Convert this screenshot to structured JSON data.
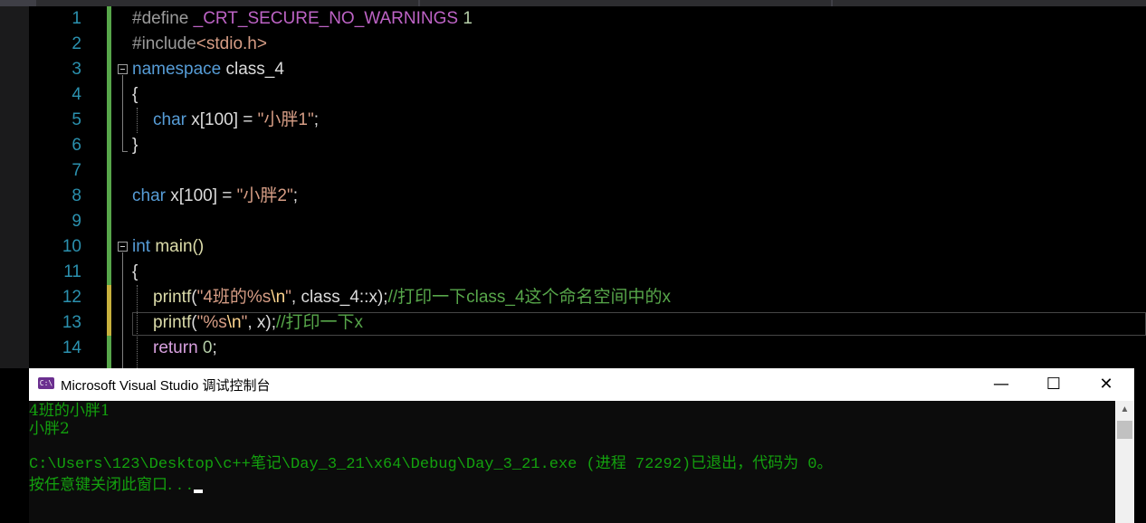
{
  "editor": {
    "line_numbers": [
      "1",
      "2",
      "3",
      "4",
      "5",
      "6",
      "7",
      "8",
      "9",
      "10",
      "11",
      "12",
      "13",
      "14"
    ],
    "lines": {
      "l1": {
        "directive": "#define",
        "macro": "_CRT_SECURE_NO_WARNINGS",
        "value": "1"
      },
      "l2": {
        "directive": "#include",
        "header": "<stdio.h>"
      },
      "l3": {
        "keyword": "namespace",
        "name": "class_4"
      },
      "l4": {
        "text": "{"
      },
      "l5": {
        "type": "char",
        "decl": "x[100]",
        "eq": " = ",
        "string": "\"小胖1\"",
        "semi": ";"
      },
      "l6": {
        "text": "}"
      },
      "l8": {
        "type": "char",
        "decl": "x[100]",
        "eq": " = ",
        "string": "\"小胖2\"",
        "semi": ";"
      },
      "l10": {
        "type": "int",
        "name": "main()"
      },
      "l11": {
        "text": "{"
      },
      "l12": {
        "fn": "printf",
        "open": "(",
        "str_a": "\"4班的%s",
        "esc": "\\n",
        "str_b": "\"",
        "args": ", class_4::x);",
        "comment": "//打印一下class_4这个命名空间中的x"
      },
      "l13": {
        "fn": "printf",
        "open": "(",
        "str_a": "\"%s",
        "esc": "\\n",
        "str_b": "\"",
        "args": ", x);",
        "comment": "//打印一下x"
      },
      "l14": {
        "keyword": "return",
        "value": "0",
        "semi": ";"
      }
    }
  },
  "console": {
    "title": "Microsoft Visual Studio 调试控制台",
    "icon_text": "C:\\",
    "minimize": "—",
    "maximize": "☐",
    "close": "✕",
    "output": [
      "4班的小胖1",
      "小胖2",
      "",
      "C:\\Users\\123\\Desktop\\c++笔记\\Day_3_21\\x64\\Debug\\Day_3_21.exe (进程 72292)已退出，代码为 0。",
      "按任意键关闭此窗口. . ."
    ],
    "text_color": "#13a10e"
  }
}
